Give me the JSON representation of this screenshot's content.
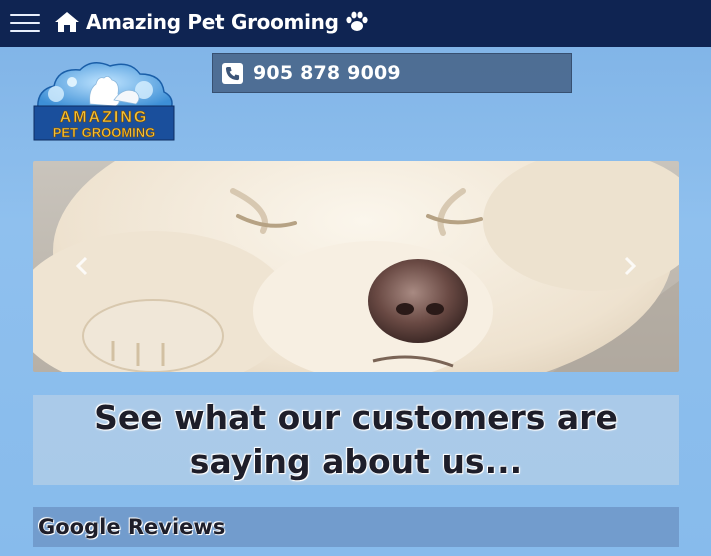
{
  "header": {
    "menu_icon": "hamburger-menu-icon",
    "home_icon": "home-icon",
    "brand_title": "Amazing Pet Grooming",
    "paw_icon": "paw-icon",
    "background_color": "#0f2452"
  },
  "logo": {
    "line1": "AMAZING",
    "line2": "PET GROOMING",
    "accent_color": "#f3c23a"
  },
  "contact": {
    "phone_icon": "phone-icon",
    "phone_number": "905 878 9009"
  },
  "carousel": {
    "prev_icon": "chevron-left-icon",
    "next_icon": "chevron-right-icon",
    "image_subject": "sleeping white dog"
  },
  "testimonials": {
    "heading": "See what our customers are saying about us..."
  },
  "reviews": {
    "heading": "Google Reviews"
  }
}
